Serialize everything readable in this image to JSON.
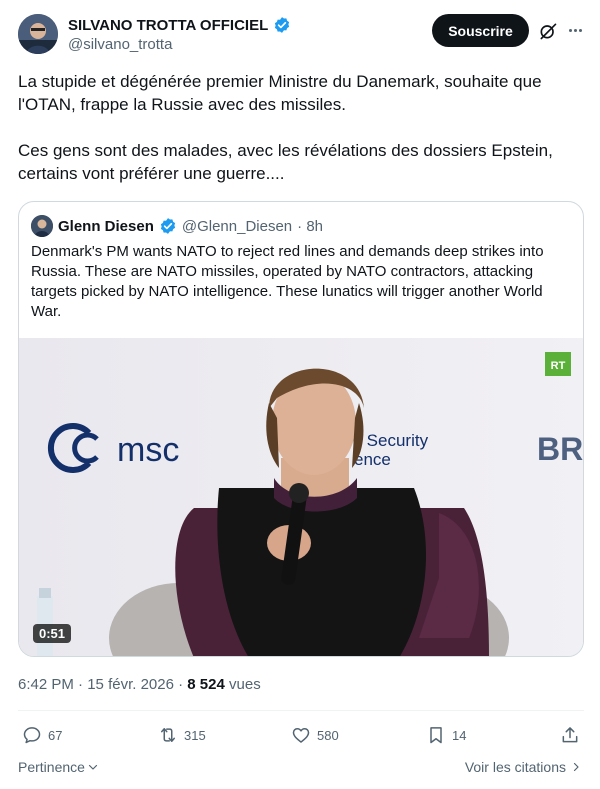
{
  "author": {
    "name": "SILVANO TROTTA OFFICIEL",
    "handle": "@silvano_trotta"
  },
  "subscribe_label": "Souscrire",
  "tweet_text": [
    "La stupide et dégénérée premier Ministre du Danemark, souhaite que l'OTAN, frappe la Russie avec des missiles.",
    "Ces gens sont des malades, avec les révélations des dossiers Epstein, certains vont préférer une guerre...."
  ],
  "quote": {
    "name": "Glenn Diesen",
    "handle": "@Glenn_Diesen",
    "time": "· 8h",
    "text": "Denmark's PM wants NATO to reject red lines and demands deep strikes into Russia. These are NATO missiles, operated by NATO contractors, attacking targets picked by NATO intelligence. These lunatics will trigger another World War.",
    "video": {
      "duration": "0:51",
      "logo_text": "msc",
      "banner_line1": "ch Security",
      "banner_line2": "ence",
      "right_logo": "BR",
      "channel_badge": "RT"
    }
  },
  "meta": {
    "time": "6:42 PM",
    "date": "15 févr. 2026",
    "views_count": "8 524",
    "views_label": "vues"
  },
  "actions": {
    "replies": "67",
    "reposts": "315",
    "likes": "580",
    "bookmarks": "14"
  },
  "footer": {
    "left": "Pertinence",
    "right": "Voir les citations"
  },
  "colors": {
    "verified": "#1d9bf0",
    "text": "#0f1419",
    "muted": "#536471"
  }
}
